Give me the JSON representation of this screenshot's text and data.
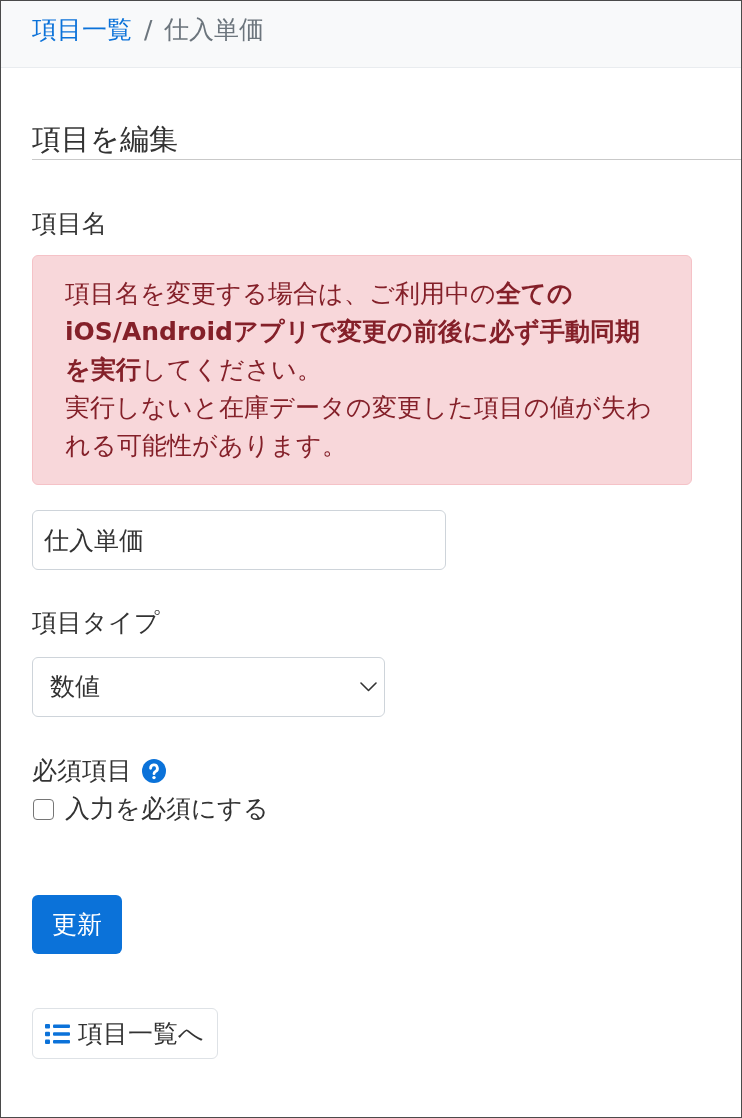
{
  "breadcrumb": {
    "items": [
      {
        "label": "項目一覧",
        "kind": "link"
      },
      {
        "label": "仕入単価",
        "kind": "current"
      }
    ],
    "separator": "/"
  },
  "heading": "項目を編集",
  "name_field": {
    "label": "項目名",
    "alert": [
      "項目名を変更する場合は、ご利用中の**全てのiOS/Androidアプリで変更の前後に必ず手動同期を実行**してください。",
      "実行しないと在庫データの変更した項目の値が失われる可能性があります。"
    ],
    "value": "仕入単価"
  },
  "type_field": {
    "label": "項目タイプ",
    "value": "数値"
  },
  "required_field": {
    "label": "必須項目",
    "checkbox": {
      "label": "入力を必須にする",
      "checked": false
    }
  },
  "buttons": [
    {
      "label": "更新",
      "kind": "primary"
    },
    {
      "label": "項目一覧へ",
      "kind": "list-link"
    }
  ]
}
